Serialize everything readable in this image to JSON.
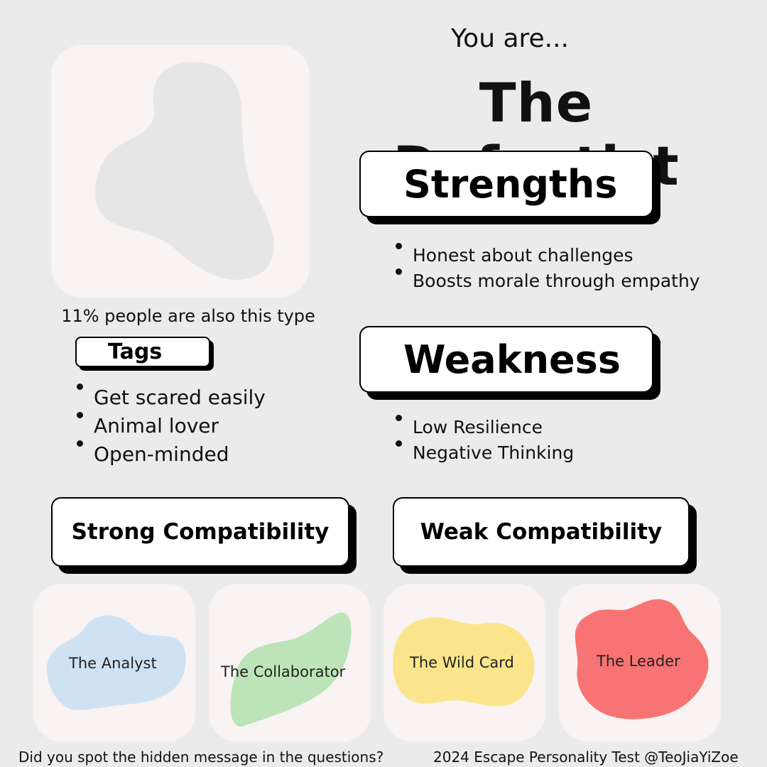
{
  "header": {
    "intro": "You are...",
    "type_name": "The Defeatist"
  },
  "type_card": {
    "share_text": "11% people are also this type"
  },
  "tags": {
    "title": "Tags",
    "items": [
      "Get scared easily",
      "Animal lover",
      "Open-minded"
    ]
  },
  "strengths": {
    "title": "Strengths",
    "items": [
      "Honest about challenges",
      "Boosts morale through empathy"
    ]
  },
  "weakness": {
    "title": "Weakness",
    "items": [
      "Low Resilience",
      "Negative Thinking"
    ]
  },
  "compatibility": {
    "strong_title": "Strong Compatibility",
    "weak_title": "Weak Compatibility",
    "strong": [
      {
        "name": "The Analyst",
        "color": "#cfe2f3"
      },
      {
        "name": "The Collaborator",
        "color": "#bde3b8"
      }
    ],
    "weak": [
      {
        "name": "The Wild Card",
        "color": "#fbe58c"
      },
      {
        "name": "The Leader",
        "color": "#f87474"
      }
    ]
  },
  "footer": {
    "left": "Did you spot the hidden message in the questions?",
    "right": "2024 Escape Personality Test @TeoJiaYiZoe"
  },
  "colors": {
    "background": "#ebebeb",
    "card": "#f9f3f3",
    "type_blob": "#e6e6e6"
  }
}
